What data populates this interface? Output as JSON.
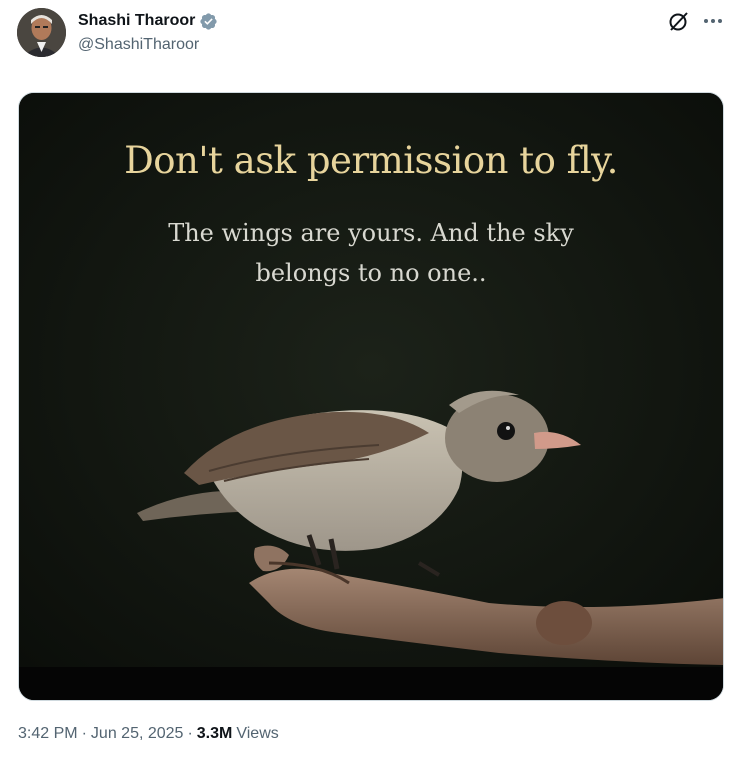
{
  "author": {
    "display_name": "Shashi Tharoor",
    "handle": "@ShashiTharoor",
    "verified": true
  },
  "media": {
    "quote_title": "Don't ask permission to fly.",
    "quote_line1": "The wings are yours. And the sky",
    "quote_line2": "belongs to no one.."
  },
  "meta": {
    "time": "3:42 PM",
    "separator": "·",
    "date": "Jun 25, 2025",
    "views_count": "3.3M",
    "views_label": "Views"
  },
  "icons": {
    "verified": "verified-badge-icon",
    "grok": "grok-icon",
    "more": "more-icon"
  },
  "colors": {
    "verified_blue": "#829aab",
    "text_primary": "#0f1419",
    "text_secondary": "#536471",
    "quote_gold": "#e7d49c"
  }
}
